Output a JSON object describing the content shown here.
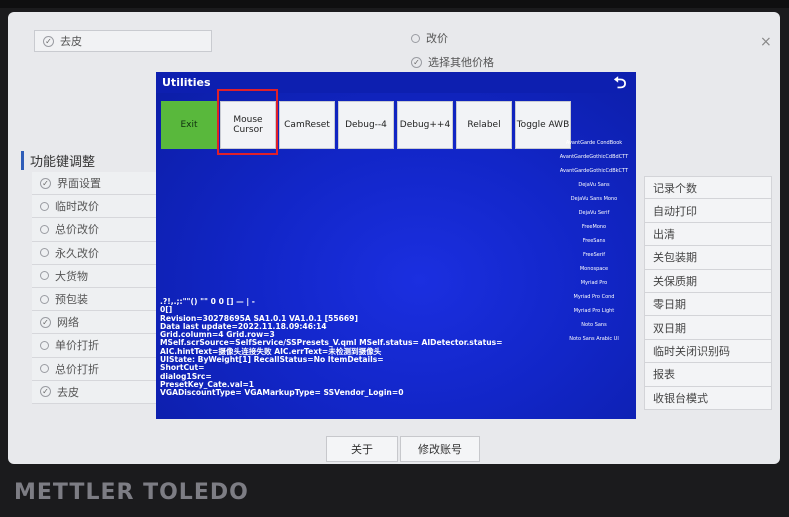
{
  "brand": "METTLER TOLEDO",
  "background_page": {
    "top_checkbox": "去皮",
    "top_options": [
      {
        "label": "改价",
        "checked": false
      },
      {
        "label": "选择其他价格",
        "checked": true
      }
    ],
    "section_title": "功能键调整",
    "left_items": [
      {
        "label": "界面设置",
        "checked": true
      },
      {
        "label": "临时改价",
        "checked": false
      },
      {
        "label": "总价改价",
        "checked": false
      },
      {
        "label": "永久改价",
        "checked": false
      },
      {
        "label": "大货物",
        "checked": false
      },
      {
        "label": "预包装",
        "checked": false
      },
      {
        "label": "网络",
        "checked": true
      },
      {
        "label": "单价打折",
        "checked": false
      },
      {
        "label": "总价打折",
        "checked": false
      },
      {
        "label": "去皮",
        "checked": true
      }
    ],
    "right_items": [
      "记录个数",
      "自动打印",
      "出清",
      "关包装期",
      "关保质期",
      "零日期",
      "双日期",
      "临时关闭识别码",
      "报表",
      "收银台模式"
    ],
    "bottom_buttons": [
      "关于",
      "修改账号"
    ]
  },
  "utilities": {
    "title": "Utilities",
    "back_icon": "back-arrow-icon",
    "buttons": [
      "Exit",
      "Mouse Cursor",
      "CamReset",
      "Debug--4",
      "Debug++4",
      "Relabel",
      "Toggle AWB"
    ],
    "selected_button": "Mouse Cursor",
    "fonts": [
      "AvantGarde CondBook",
      "AvantGardeGothicCdBdCTT",
      "AvantGardeGothicCdBkCTT",
      "DejaVu Sans",
      "DejaVu Sans Mono",
      "DejaVu Serif",
      "FreeMono",
      "FreeSans",
      "FreeSerif",
      "Monospace",
      "Myriad Pro",
      "Myriad Pro Cond",
      "Myriad Pro Light",
      "Noto Sans",
      "Noto Sans Arabic UI"
    ],
    "info_lines": [
      ".?!,.;:\"\"() \"\" 0 0 [] — | -",
      "0[]",
      "Revision=30278695A SA1.0.1 VA1.0.1 [55669]",
      "Data last update=2022.11.18.09:46:14",
      "Grid.column=4 Grid.row=3",
      "MSelf.scrSource=SelfService/SSPresets_V.qml MSelf.status= AIDetector.status=",
      "AIC.hintText=摄像头连接失败 AIC.errText=未检测到摄像头",
      "UIState: ByWeight[1] RecallStatus=No ItemDetails=",
      "ShortCut=",
      "dialog1Src=",
      "PresetKey_Cate.val=1",
      "VGADiscountType= VGAMarkupType= SSVendor_Login=0"
    ]
  },
  "colors": {
    "overlay_blue": "#1226c8",
    "exit_green": "#59b83c",
    "highlight_red": "#e0202a"
  }
}
